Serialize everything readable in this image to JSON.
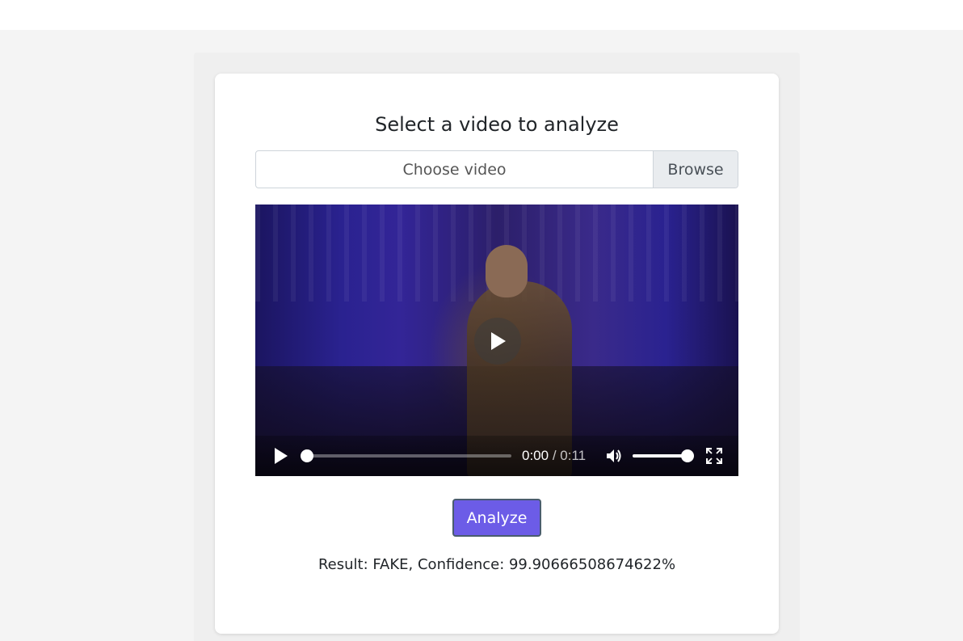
{
  "form": {
    "title": "Select a video to analyze",
    "file_placeholder": "Choose video",
    "browse_label": "Browse"
  },
  "video": {
    "current_time": "0:00",
    "separator": "/",
    "duration": "0:11",
    "progress_fraction": 0,
    "volume_fraction": 1.0,
    "icons": {
      "play": "play-icon",
      "big_play": "play-icon",
      "volume": "volume-icon",
      "fullscreen": "fullscreen-icon"
    }
  },
  "actions": {
    "analyze_label": "Analyze"
  },
  "result": {
    "text": "Result: FAKE, Confidence: 99.90666508674622%"
  },
  "colors": {
    "page_bg": "#f4f4f4",
    "card_bg": "#ffffff",
    "accent": "#6c5ce7"
  }
}
